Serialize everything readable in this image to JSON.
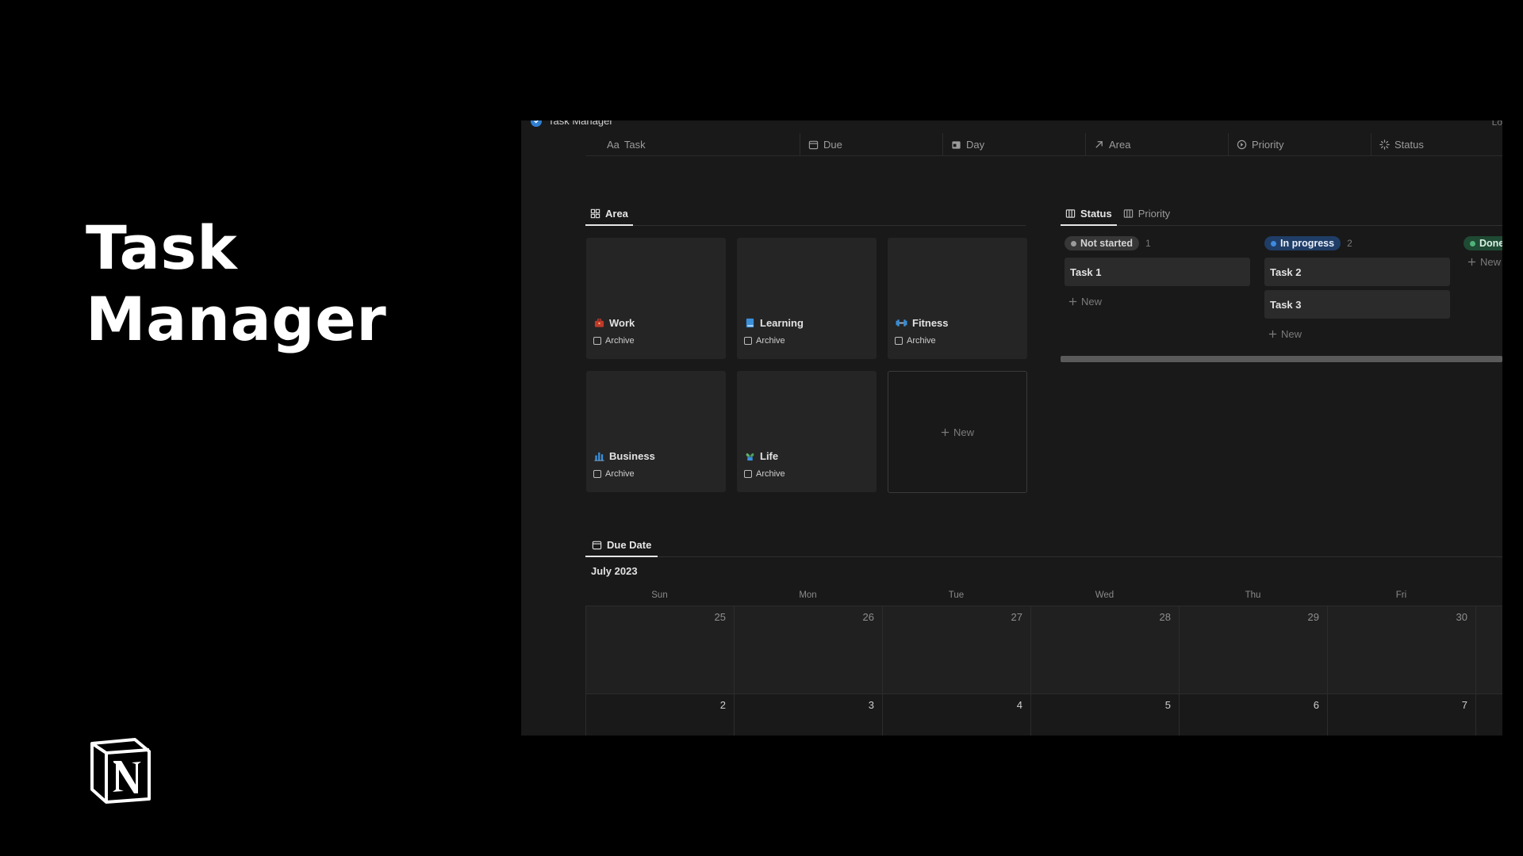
{
  "hero": {
    "title_line1": "Task",
    "title_line2": "Manager"
  },
  "app": {
    "page_title": "Task Manager",
    "corner_text": "Lo",
    "properties": [
      {
        "label": "Task",
        "prefix": "Aa",
        "icon": "text-icon"
      },
      {
        "label": "Due",
        "icon": "calendar-icon"
      },
      {
        "label": "Day",
        "icon": "calendar-day-icon"
      },
      {
        "label": "Area",
        "icon": "arrow-up-right-icon"
      },
      {
        "label": "Priority",
        "icon": "circle-dot-icon"
      },
      {
        "label": "Status",
        "icon": "spinner-icon"
      }
    ],
    "gallery": {
      "tab_label": "Area",
      "cards": [
        {
          "title": "Work",
          "icon": "briefcase-icon",
          "archive_label": "Archive"
        },
        {
          "title": "Learning",
          "icon": "book-icon",
          "archive_label": "Archive"
        },
        {
          "title": "Fitness",
          "icon": "dumbbell-icon",
          "archive_label": "Archive"
        },
        {
          "title": "Business",
          "icon": "bar-chart-icon",
          "archive_label": "Archive"
        },
        {
          "title": "Life",
          "icon": "plant-icon",
          "archive_label": "Archive"
        }
      ],
      "new_label": "New"
    },
    "board": {
      "tabs": [
        {
          "label": "Status",
          "active": true
        },
        {
          "label": "Priority",
          "active": false
        }
      ],
      "columns": [
        {
          "label": "Not started",
          "count": "1",
          "pill_bg": "#373737",
          "pill_fg": "#d4d4d4",
          "dot": "#9b9b9b",
          "cards": [
            "Task 1"
          ],
          "new_label": "New"
        },
        {
          "label": "In progress",
          "count": "2",
          "pill_bg": "#1f3d66",
          "pill_fg": "#e6eefb",
          "dot": "#3d8ae0",
          "cards": [
            "Task 2",
            "Task 3"
          ],
          "new_label": "New"
        },
        {
          "label": "Done",
          "count": "",
          "pill_bg": "#1f4a33",
          "pill_fg": "#d9f2e4",
          "dot": "#4fb37a",
          "cards": [],
          "new_label": "New"
        }
      ]
    },
    "calendar": {
      "tab_label": "Due Date",
      "month": "July 2023",
      "weekdays": [
        "Sun",
        "Mon",
        "Tue",
        "Wed",
        "Thu",
        "Fri"
      ],
      "weeks": [
        [
          "25",
          "26",
          "27",
          "28",
          "29",
          "30"
        ],
        [
          "2",
          "3",
          "4",
          "5",
          "6",
          "7"
        ]
      ]
    }
  },
  "colors": {
    "background": "#000000",
    "app_bg": "#191919",
    "card_bg": "#252525",
    "accent_blue": "#2f7fd1"
  }
}
